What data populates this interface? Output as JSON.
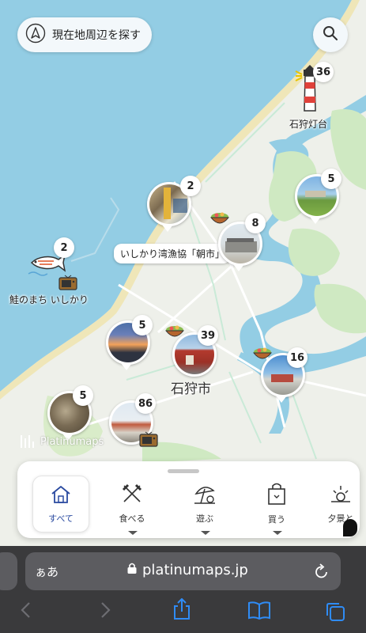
{
  "map": {
    "locate_label": "現在地周辺を探す",
    "icons": {
      "locate": "navigation-arrow-icon",
      "search": "search-icon"
    },
    "lighthouse": {
      "count": "36",
      "label": "石狩灯台"
    },
    "salmon": {
      "count": "2",
      "label": "鮭のまち いしかり"
    },
    "pins": [
      {
        "id": "market",
        "count": "2",
        "callout": "いしかり湾漁協「朝市」"
      },
      {
        "id": "building",
        "count": "8"
      },
      {
        "id": "park",
        "count": "5"
      },
      {
        "id": "sunset",
        "count": "5"
      },
      {
        "id": "city",
        "count": "39"
      },
      {
        "id": "bridge",
        "count": "16"
      },
      {
        "id": "oysters",
        "count": "5"
      },
      {
        "id": "station",
        "count": "86"
      }
    ],
    "city_label": "石狩市",
    "watermark": "Platinumaps"
  },
  "categories": [
    {
      "label": "すべて",
      "icon": "home-icon",
      "active": true
    },
    {
      "label": "食べる",
      "icon": "fork-knife-icon",
      "active": false
    },
    {
      "label": "遊ぶ",
      "icon": "beach-umbrella-icon",
      "active": false
    },
    {
      "label": "買う",
      "icon": "shopping-bag-icon",
      "active": false
    },
    {
      "label": "夕景と",
      "icon": "sunset-icon",
      "active": false
    }
  ],
  "browser": {
    "aa_label": "ぁあ",
    "url": "platinumaps.jp",
    "toolbar": [
      "back-icon",
      "forward-icon",
      "share-icon",
      "bookmarks-icon",
      "tabs-icon"
    ]
  },
  "colors": {
    "sea": "#93cde4",
    "land": "#eef0ea",
    "green": "#cfe9c2",
    "accent": "#2a4aa0",
    "browser_bg": "#3a3a3c"
  }
}
